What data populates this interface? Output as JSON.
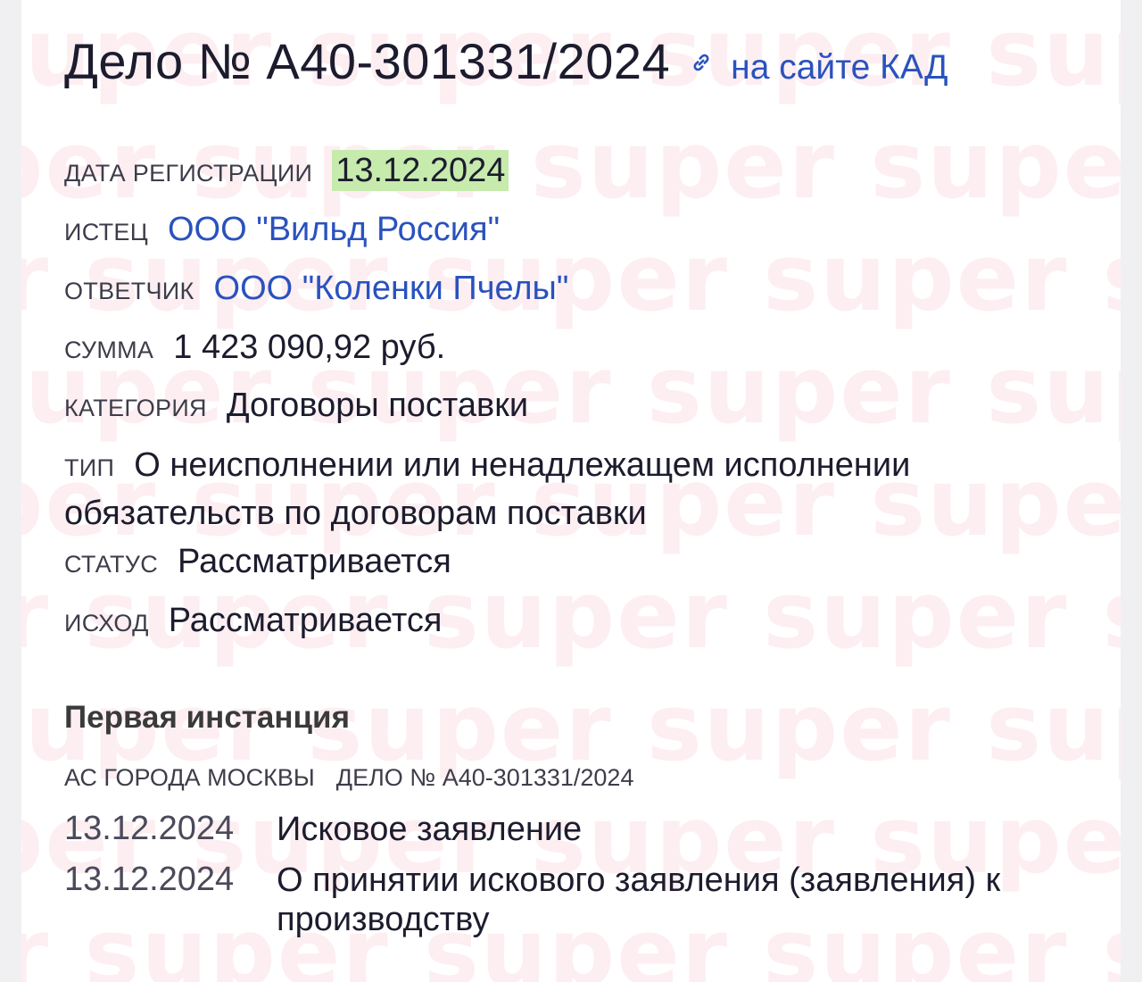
{
  "header": {
    "title": "Дело № А40-301331/2024",
    "link_icon": "link-icon",
    "kad_link_label": "на сайте КАД"
  },
  "fields": {
    "registration_date": {
      "label": "ДАТА РЕГИСТРАЦИИ",
      "value": "13.12.2024"
    },
    "plaintiff": {
      "label": "ИСТЕЦ",
      "value": "ООО \"Вильд Россия\""
    },
    "defendant": {
      "label": "ОТВЕТЧИК",
      "value": "ООО \"Коленки Пчелы\""
    },
    "amount": {
      "label": "СУММА",
      "value": "1 423 090,92 руб."
    },
    "category": {
      "label": "КАТЕГОРИЯ",
      "value": "Договоры поставки"
    },
    "type": {
      "label": "ТИП",
      "value": "О неисполнении или ненадлежащем исполнении обязательств по договорам поставки"
    },
    "status": {
      "label": "СТАТУС",
      "value": "Рассматривается"
    },
    "outcome": {
      "label": "ИСХОД",
      "value": "Рассматривается"
    }
  },
  "first_instance": {
    "title": "Первая инстанция",
    "court": "АС ГОРОДА МОСКВЫ",
    "case_ref": "ДЕЛО № А40-301331/2024",
    "events": [
      {
        "date": "13.12.2024",
        "description": "Исковое заявление"
      },
      {
        "date": "13.12.2024",
        "description": "О принятии искового заявления (заявления) к производству"
      }
    ]
  },
  "watermark": {
    "text": "super super super super super"
  },
  "colors": {
    "link": "#2a52be",
    "date_highlight": "#c6ebad",
    "watermark": "#ee5a78"
  }
}
